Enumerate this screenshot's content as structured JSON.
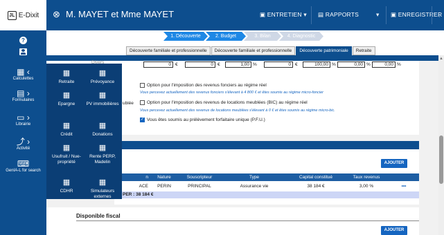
{
  "app": {
    "logo_text": "JL",
    "name": "E-Dixit"
  },
  "sidebar": {
    "help_icon": "?",
    "items": [
      {
        "label": "Calculettes",
        "icon": "calculator-icon"
      },
      {
        "label": "Formulaires",
        "icon": "form-icon"
      },
      {
        "label": "Librairie",
        "icon": "library-icon"
      },
      {
        "label": "Activité",
        "icon": "chart-icon"
      },
      {
        "label": "GenIA-L for search",
        "icon": "ai-icon"
      }
    ]
  },
  "header": {
    "title": "M. MAYET et Mme MAYET",
    "entretien": "ENTRETIEN",
    "rapports": "RAPPORTS",
    "enregistrer": "ENREGISTRER"
  },
  "steps": [
    "1. Découverte",
    "2. Budget",
    "3. Bilan",
    "4. Diagnostic"
  ],
  "tabs": [
    "Découverte familiale et professionnelle",
    "Découverte familiale et professionnelle",
    "Découverte patrimoniale",
    "Retraite"
  ],
  "form": {
    "divers_label": "Divers",
    "inputs": [
      "0",
      "0",
      "1,00",
      "0",
      "100,00",
      "0,00",
      "0,00"
    ],
    "units": [
      "€",
      "€",
      "%",
      "€",
      "%",
      "%",
      "%"
    ],
    "meubles_fragment": "ublée",
    "opt1": "Option pour l'imposition des revenus fonciers au régime réel",
    "info1": "Vous percevez actuellement des revenus fonciers s'élevant à 4 800 € et êtes soumis au régime micro-foncier",
    "opt2": "Option pour l'imposition des revenus de locations meublées (BIC) au régime réel",
    "info2": "Vous percevez actuellement des revenus de locations meublées s'élevant à 0 € et êtes soumis au régime micro-bic.",
    "opt3": "Vous êtes soumis au prélèvement forfaitaire unique (P.F.U.)"
  },
  "capital": {
    "section_fragment": ")",
    "add_label": "AJOUTER",
    "headers": [
      "n",
      "Nature",
      "Souscripteur",
      "Type",
      "Capital constitué",
      "Taux revenus",
      ""
    ],
    "rows": [
      [
        "ACE",
        "PERIN",
        "PRINCIPAL",
        "Assurance vie",
        "38 184 €",
        "3,00 %",
        "•••"
      ]
    ],
    "total": "PER : 38 184 €"
  },
  "dispo": {
    "title": "Disponible fiscal",
    "add_label": "AJOUTER"
  },
  "popup": {
    "items": [
      "Retraite",
      "Prévoyance",
      "Epargne",
      "PV immobilières",
      "Crédit",
      "Donations",
      "Usufruit / Nue-propriété",
      "Rente PERP, Madelin",
      "CDHR",
      "Simulateurs externes"
    ]
  },
  "colors": {
    "primary": "#0d4e8e",
    "accent": "#1565c0",
    "step_active": "#1e88e5",
    "step_inactive": "#cfd8e6"
  }
}
